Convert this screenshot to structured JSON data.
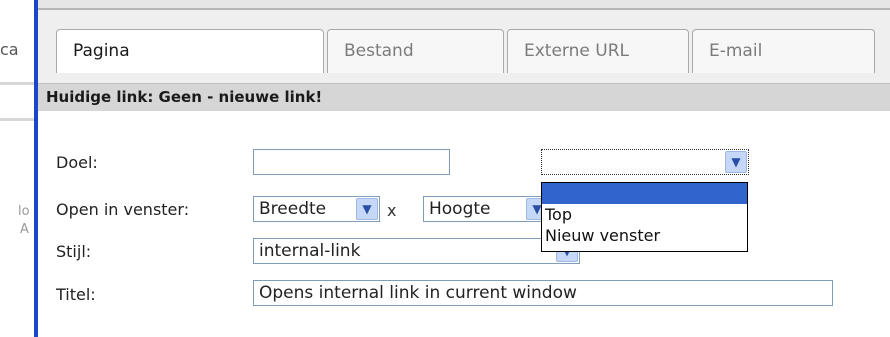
{
  "background": {
    "fragments": [
      "ca",
      "lo",
      "A"
    ]
  },
  "tabs": [
    {
      "label": "Pagina",
      "active": true
    },
    {
      "label": "Bestand",
      "active": false
    },
    {
      "label": "Externe URL",
      "active": false
    },
    {
      "label": "E-mail",
      "active": false
    }
  ],
  "status": {
    "current_link": "Huidige link: Geen - nieuwe link!"
  },
  "form": {
    "target": {
      "label": "Doel:",
      "value": "",
      "select_value": ""
    },
    "window": {
      "label": "Open in venster:",
      "width_value": "Breedte",
      "times": "x",
      "height_value": "Hoogte"
    },
    "style": {
      "label": "Stijl:",
      "value": "internal-link"
    },
    "title": {
      "label": "Titel:",
      "value": "Opens internal link in current window"
    }
  },
  "target_dropdown": {
    "options": [
      "",
      "Top",
      "Nieuw venster"
    ],
    "highlighted_index": 0
  },
  "colors": {
    "frame_border": "#1c45c8",
    "highlight": "#3164cc",
    "status_bar": "#d6d6d6"
  },
  "icons": {
    "select_arrow": "chevron-down-icon"
  }
}
